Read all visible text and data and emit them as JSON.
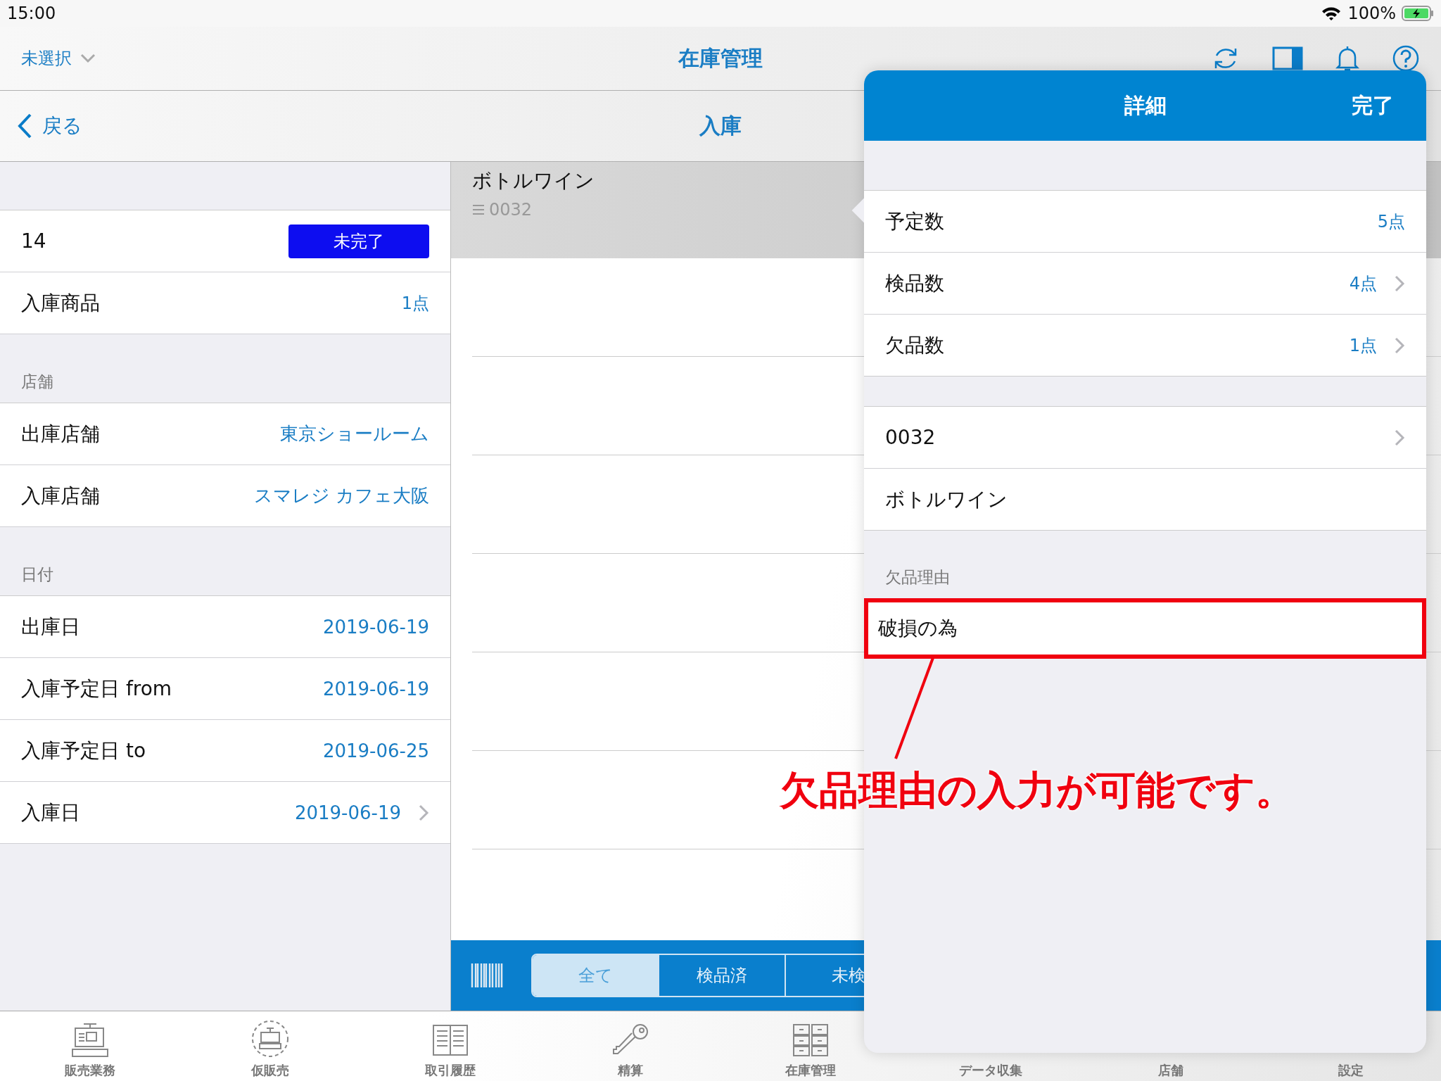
{
  "status_bar": {
    "time": "15:00",
    "battery": "100%"
  },
  "nav_bar": {
    "store_picker": "未選択",
    "title": "在庫管理"
  },
  "sub_header": {
    "back": "戻る",
    "title": "入庫"
  },
  "summary": {
    "number": "14",
    "status": "未完了",
    "rows": [
      {
        "label": "入庫商品",
        "value": "1点",
        "chevron": false
      }
    ]
  },
  "sections": [
    {
      "header": "店舗",
      "rows": [
        {
          "label": "出庫店舗",
          "value": "東京ショールーム",
          "chevron": false
        },
        {
          "label": "入庫店舗",
          "value": "スマレジ カフェ大阪",
          "chevron": false
        }
      ]
    },
    {
      "header": "日付",
      "rows": [
        {
          "label": "出庫日",
          "value": "2019-06-19",
          "chevron": false
        },
        {
          "label": "入庫予定日 from",
          "value": "2019-06-19",
          "chevron": false
        },
        {
          "label": "入庫予定日 to",
          "value": "2019-06-25",
          "chevron": false
        },
        {
          "label": "入庫日",
          "value": "2019-06-19",
          "chevron": true
        }
      ]
    }
  ],
  "items": [
    {
      "name": "ボトルワイン",
      "code": "0032",
      "selected": true
    }
  ],
  "filter": {
    "segments": [
      {
        "label": "全て",
        "selected": true
      },
      {
        "label": "検品済",
        "selected": false
      },
      {
        "label": "未検",
        "selected": false
      }
    ]
  },
  "popover": {
    "title": "詳細",
    "done": "完了",
    "counts": [
      {
        "label": "予定数",
        "value": "5点",
        "chevron": false
      },
      {
        "label": "検品数",
        "value": "4点",
        "chevron": true
      },
      {
        "label": "欠品数",
        "value": "1点",
        "chevron": true
      }
    ],
    "product": [
      {
        "label": "0032",
        "chevron": true
      },
      {
        "label": "ボトルワイン",
        "chevron": false
      }
    ],
    "reason_header": "欠品理由",
    "reason_value": "破損の為"
  },
  "annotation": {
    "text": "欠品理由の入力が可能です。"
  },
  "tab_bar": [
    {
      "label": "販売業務",
      "kind": "register"
    },
    {
      "label": "仮販売",
      "kind": "temp-register"
    },
    {
      "label": "取引履歴",
      "kind": "book"
    },
    {
      "label": "精算",
      "kind": "key"
    },
    {
      "label": "在庫管理",
      "kind": "cabinet"
    },
    {
      "label": "データ収集",
      "kind": "hidden"
    },
    {
      "label": "店舗",
      "kind": "hidden"
    },
    {
      "label": "設定",
      "kind": "hidden"
    }
  ]
}
